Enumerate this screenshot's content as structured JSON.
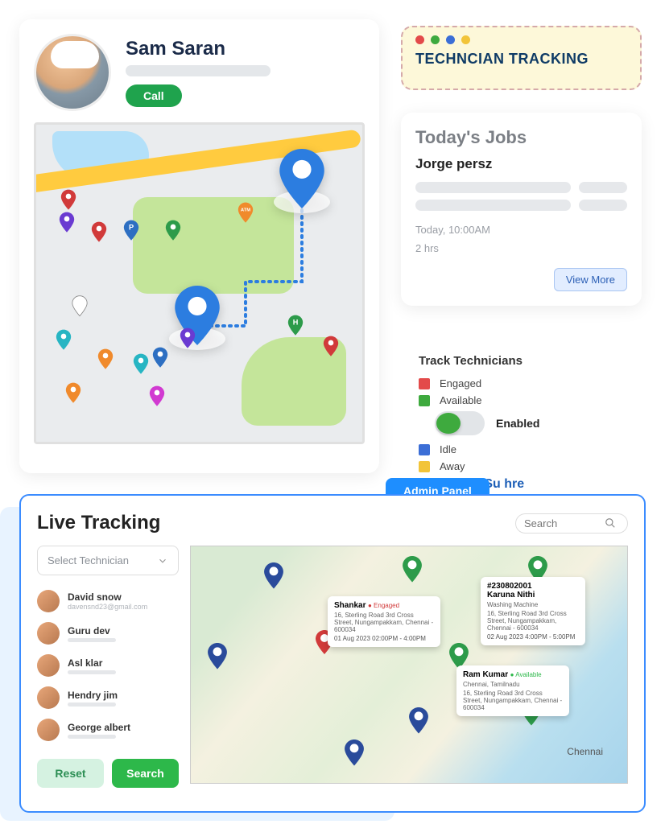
{
  "profile": {
    "name": "Sam Saran",
    "call": "Call"
  },
  "banner": {
    "title": "TECHNCIAN TRACKING",
    "dots": [
      "#e34a4a",
      "#3eaa3e",
      "#3b6ed6",
      "#f2c439"
    ]
  },
  "jobs": {
    "title": "Today's Jobs",
    "customer": "Jorge persz",
    "time": "Today, 10:00AM",
    "duration": "2 hrs",
    "view_more": "View More"
  },
  "legend": {
    "title": "Track Technicians",
    "items": [
      {
        "color": "#e34a4a",
        "label": "Engaged"
      },
      {
        "color": "#3eaa3e",
        "label": "Available"
      },
      {
        "color": "#3b6ed6",
        "label": "Idle"
      },
      {
        "color": "#f2c439",
        "label": "Away"
      }
    ],
    "toggle_label": "Enabled",
    "go_text": "GO : xlcSu hre"
  },
  "admin": {
    "tab": "Admin Panel",
    "title": "Live Tracking",
    "search_placeholder": "Search",
    "select_label": "Select Technician",
    "technicians": [
      {
        "name": "David snow",
        "mail": "davensnd23@gmail.com"
      },
      {
        "name": "Guru dev",
        "mail": ""
      },
      {
        "name": "Asl klar",
        "mail": ""
      },
      {
        "name": "Hendry jim",
        "mail": ""
      },
      {
        "name": "George albert",
        "mail": ""
      }
    ],
    "reset": "Reset",
    "search": "Search",
    "callouts": {
      "c1": {
        "name": "Shankar",
        "status": "● Engaged",
        "addr": "16, Sterling Road 3rd Cross Street, Nungampakkam, Chennai - 600034",
        "date": "01 Aug 2023 02:00PM - 4:00PM"
      },
      "c2": {
        "id": "#230802001",
        "name": "Karuna Nithi",
        "service": "Washing Machine",
        "addr": "16, Sterling Road 3rd Cross Street, Nungampakkam, Chennai - 600034",
        "date": "02 Aug 2023 4:00PM - 5:00PM"
      },
      "c3": {
        "name": "Ram Kumar",
        "status": "● Available",
        "loc": "Chennai, Tamilnadu",
        "addr": "16, Sterling Road 3rd Cross Street, Nungampakkam, Chennai - 600034"
      }
    },
    "city": "Chennai"
  }
}
